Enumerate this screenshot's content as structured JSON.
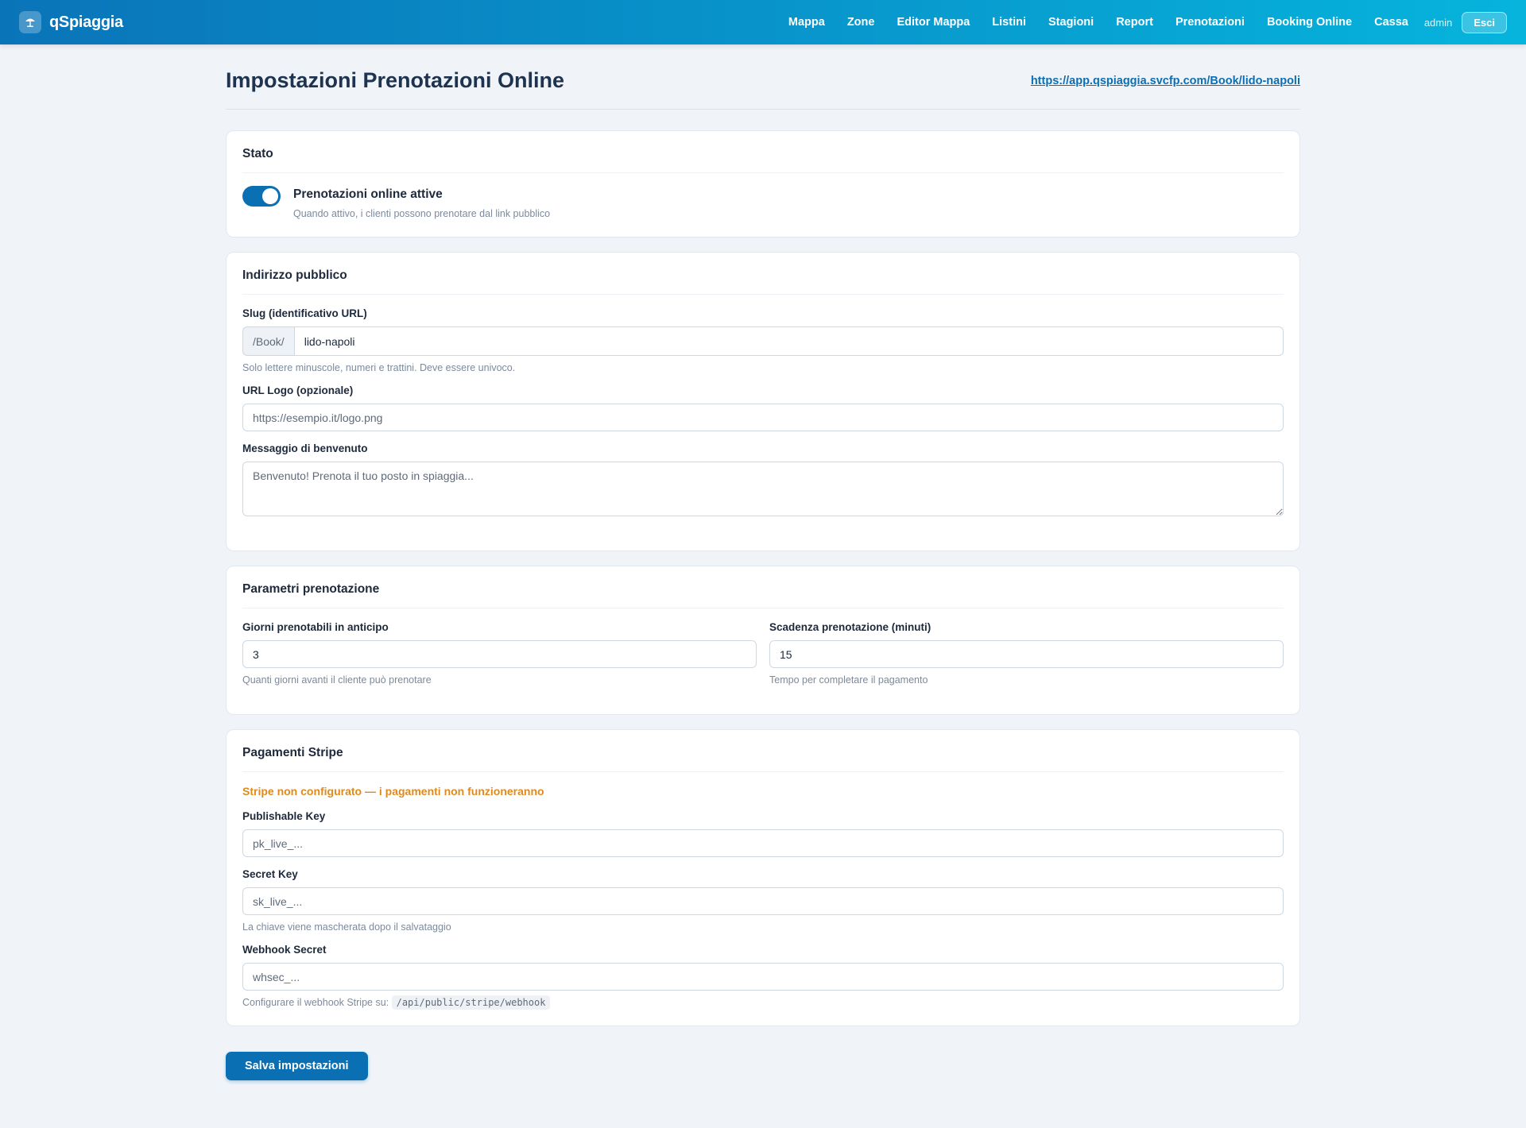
{
  "brand": {
    "name": "qSpiaggia",
    "icon": "umbrella-icon"
  },
  "nav": {
    "items": [
      {
        "label": "Mappa"
      },
      {
        "label": "Zone"
      },
      {
        "label": "Editor Mappa"
      },
      {
        "label": "Listini"
      },
      {
        "label": "Stagioni"
      },
      {
        "label": "Report"
      },
      {
        "label": "Prenotazioni"
      },
      {
        "label": "Booking Online"
      },
      {
        "label": "Cassa"
      }
    ],
    "user": "admin",
    "logout_label": "Esci"
  },
  "page": {
    "title": "Impostazioni Prenotazioni Online",
    "public_url": "https://app.qspiaggia.svcfp.com/Book/lido-napoli"
  },
  "stato": {
    "title": "Stato",
    "toggle_label": "Prenotazioni online attive",
    "toggle_help": "Quando attivo, i clienti possono prenotare dal link pubblico",
    "enabled": true
  },
  "indirizzo": {
    "title": "Indirizzo pubblico",
    "slug_label": "Slug (identificativo URL)",
    "slug_prefix": "/Book/",
    "slug_value": "lido-napoli",
    "slug_help": "Solo lettere minuscole, numeri e trattini. Deve essere univoco.",
    "logo_label": "URL Logo (opzionale)",
    "logo_placeholder": "https://esempio.it/logo.png",
    "welcome_label": "Messaggio di benvenuto",
    "welcome_placeholder": "Benvenuto! Prenota il tuo posto in spiaggia..."
  },
  "parametri": {
    "title": "Parametri prenotazione",
    "days_label": "Giorni prenotabili in anticipo",
    "days_value": "3",
    "days_help": "Quanti giorni avanti il cliente può prenotare",
    "expiry_label": "Scadenza prenotazione (minuti)",
    "expiry_value": "15",
    "expiry_help": "Tempo per completare il pagamento"
  },
  "stripe": {
    "title": "Pagamenti Stripe",
    "warning": "Stripe non configurato — i pagamenti non funzioneranno",
    "warning_color": "#e08a1e",
    "pk_label": "Publishable Key",
    "pk_placeholder": "pk_live_...",
    "sk_label": "Secret Key",
    "sk_placeholder": "sk_live_...",
    "sk_help": "La chiave viene mascherata dopo il salvataggio",
    "wh_label": "Webhook Secret",
    "wh_placeholder": "whsec_...",
    "wh_help": "Configurare il webhook Stripe su:",
    "wh_endpoint": "/api/public/stripe/webhook"
  },
  "actions": {
    "save_label": "Salva impostazioni"
  },
  "colors": {
    "primary": "#0b6fb3",
    "header_start": "#0a74b9",
    "header_end": "#06b4dc"
  }
}
